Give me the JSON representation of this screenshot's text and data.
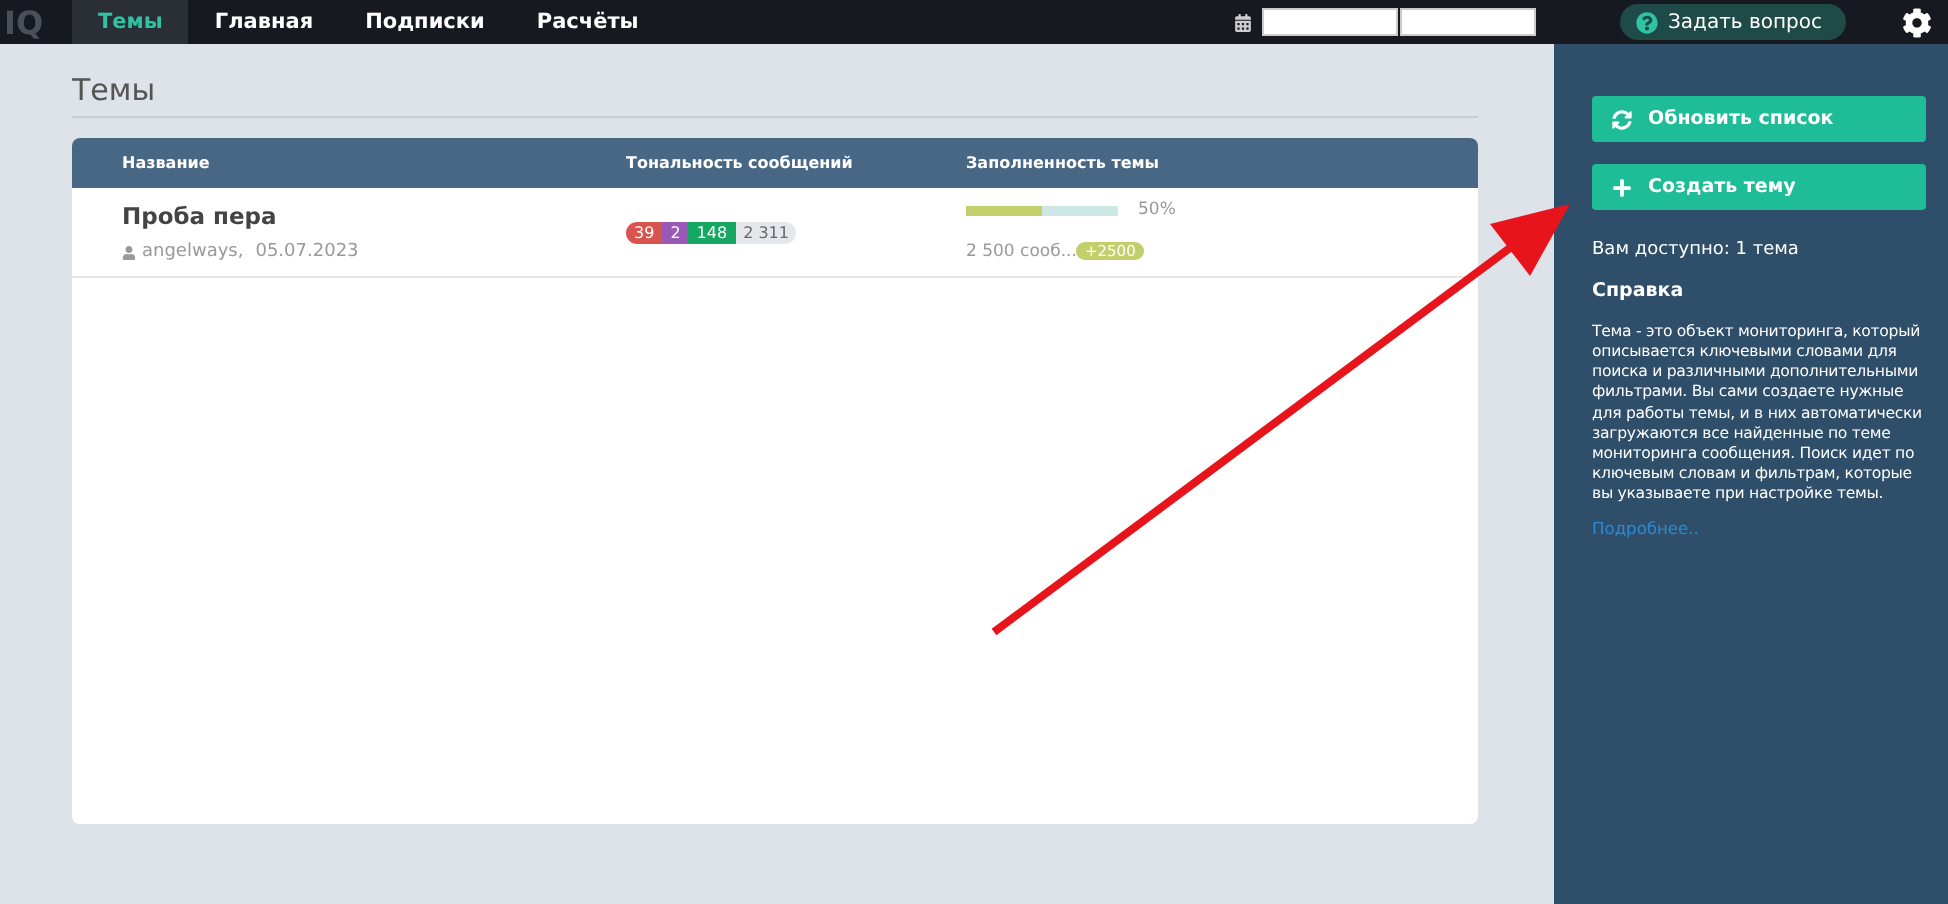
{
  "logo": "IQ",
  "nav": [
    {
      "label": "Темы",
      "selected": true
    },
    {
      "label": "Главная",
      "selected": false
    },
    {
      "label": "Подписки",
      "selected": false
    },
    {
      "label": "Расчёты",
      "selected": false
    }
  ],
  "help_button": "Задать вопрос",
  "page_title": "Темы",
  "table": {
    "columns": [
      "Название",
      "Тональность сообщений",
      "Заполненность темы"
    ],
    "rows": [
      {
        "name": "Проба пера",
        "author": "angelways,",
        "date": "05.07.2023",
        "sentiment": [
          {
            "value": "39",
            "color": "#d9534f"
          },
          {
            "value": "2",
            "color": "#9b59b6"
          },
          {
            "value": "148",
            "color": "#16a762"
          },
          {
            "value": "2 311",
            "color": "#e4e8ec"
          }
        ],
        "fill": {
          "level": 0.5,
          "percent": "50%",
          "count": "2 500 сооб...",
          "extra": "+2500"
        }
      }
    ]
  },
  "sidebar": {
    "buttons": [
      {
        "label": "Обновить список",
        "kind": "refresh"
      },
      {
        "label": "Создать тему",
        "kind": "add"
      }
    ],
    "available": "Вам доступно: 1 тема",
    "help_title": "Справка",
    "help_text": "Тема - это объект мониторинга, который описывается ключевыми словами для поиска и различными дополнительными фильтрами. Вы сами создаете нужные для работы темы, и в них автоматически загружаются все найденные по теме мониторинга сообщения. Поиск идет по ключевым словам и фильтрам, которые вы указываете при настройке темы.",
    "more_link": "Подробнее.."
  }
}
